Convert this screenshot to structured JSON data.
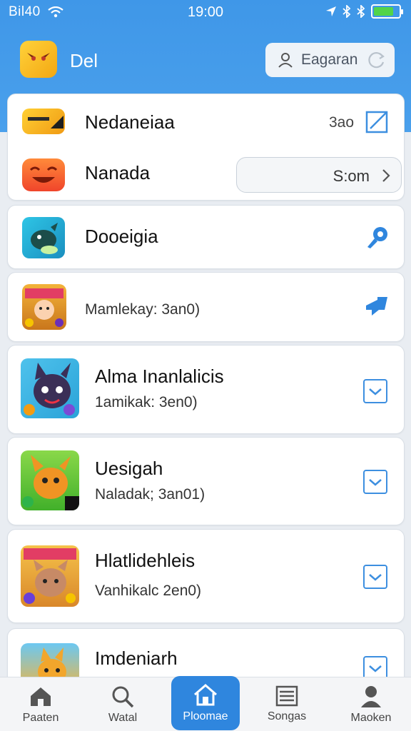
{
  "status_bar": {
    "carrier": "Bil40",
    "time": "19:00"
  },
  "header": {
    "title": "Del",
    "search_placeholder": "Eagaran"
  },
  "items": [
    {
      "title": "Nedaneiaa",
      "right_text": "3ao"
    },
    {
      "title": "Nanada",
      "pill_text": "S:om"
    },
    {
      "title": "Dooeigia"
    },
    {
      "subtitle": "Mamlekay: 3an0)"
    },
    {
      "title": "Alma Inanlalicis",
      "subtitle": "1amikak: 3en0)"
    },
    {
      "title": "Uesigah",
      "subtitle": "Naladak; 3an01)"
    },
    {
      "title": "Hlatlidehleis",
      "subtitle": "Vanhikalc 2en0)"
    },
    {
      "title": "Imdeniarh"
    }
  ],
  "tabs": [
    {
      "label": "Paaten",
      "icon": "home-icon"
    },
    {
      "label": "Watal",
      "icon": "search-icon"
    },
    {
      "label": "Ploomae",
      "icon": "home-icon",
      "active": true
    },
    {
      "label": "Songas",
      "icon": "list-icon"
    },
    {
      "label": "Maoken",
      "icon": "profile-icon"
    }
  ],
  "colors": {
    "accent": "#2f86de",
    "header": "#4aa0ec",
    "battery": "#52d44a"
  }
}
